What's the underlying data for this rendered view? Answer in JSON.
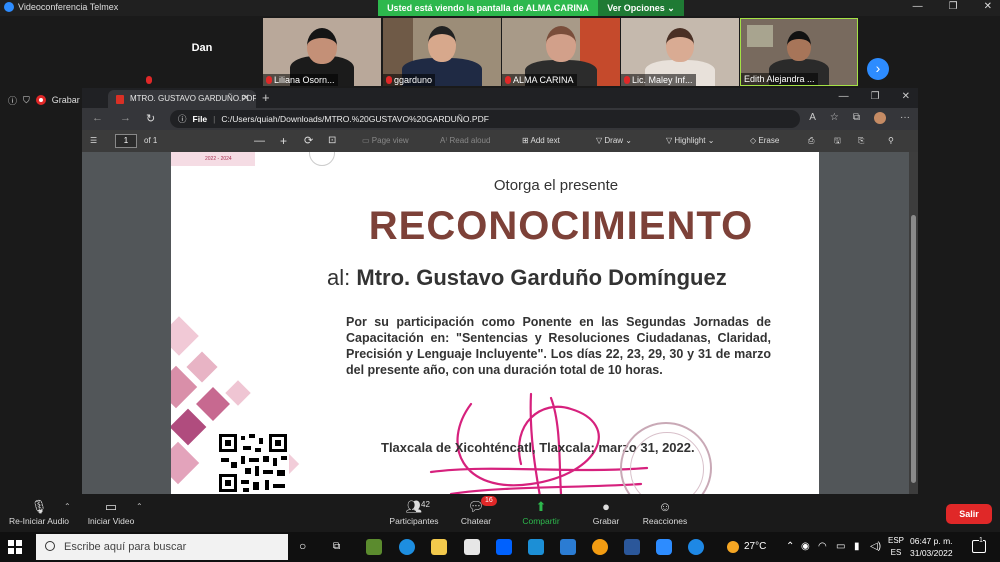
{
  "zoom": {
    "app_title": "Videoconferencia Telmex",
    "share_banner": "Usted está viendo la pantalla de ALMA CARINA",
    "view_options": "Ver Opciones ⌄",
    "record_label": "Grabar",
    "participants": [
      {
        "name": "Dan"
      },
      {
        "name": "Liliana Osorn..."
      },
      {
        "name": "ggarduno"
      },
      {
        "name": "ALMA CARINA"
      },
      {
        "name": "Lic. Maley Inf..."
      },
      {
        "name": "Edith Alejandra ..."
      }
    ],
    "controls": {
      "audio": "Re-Iniciar Audio",
      "video": "Iniciar Video",
      "participants": "Participantes",
      "participants_count": "42",
      "chat": "Chatear",
      "chat_badge": "16",
      "share": "Compartir",
      "record": "Grabar",
      "reactions": "Reacciones",
      "leave": "Salir"
    }
  },
  "browser": {
    "tab_title": "MTRO. GUSTAVO GARDUÑO.PDF",
    "address_label": "File",
    "address": "C:/Users/quiah/Downloads/MTRO.%20GUSTAVO%20GARDUÑO.PDF",
    "pdf_toolbar": {
      "page_current": "1",
      "page_total": "of 1",
      "page_view": "Page view",
      "read_aloud": "Read aloud",
      "add_text": "Add text",
      "draw": "Draw",
      "highlight": "Highlight",
      "erase": "Erase"
    }
  },
  "certificate": {
    "years": "2022 - 2024",
    "intro": "Otorga el presente",
    "title": "RECONOCIMIENTO",
    "recipient_prefix": "al:",
    "recipient": "Mtro. Gustavo Garduño Domínguez",
    "body": "Por su participación como Ponente en las Segundas Jornadas de Capacitación en: \"Sentencias y Resoluciones Ciudadanas, Claridad, Precisión y Lenguaje Incluyente\". Los días 22, 23, 29, 30 y 31 de marzo del presente año, con una duración total de 10 horas.",
    "place_date": "Tlaxcala de Xicohténcatl, Tlaxcala; marzo 31, 2022."
  },
  "taskbar": {
    "search_placeholder": "Escribe aquí para buscar",
    "weather": "27°C",
    "lang_1": "ESP",
    "lang_2": "ES",
    "time": "06:47 p. m.",
    "date": "31/03/2022",
    "notifications": "1"
  }
}
